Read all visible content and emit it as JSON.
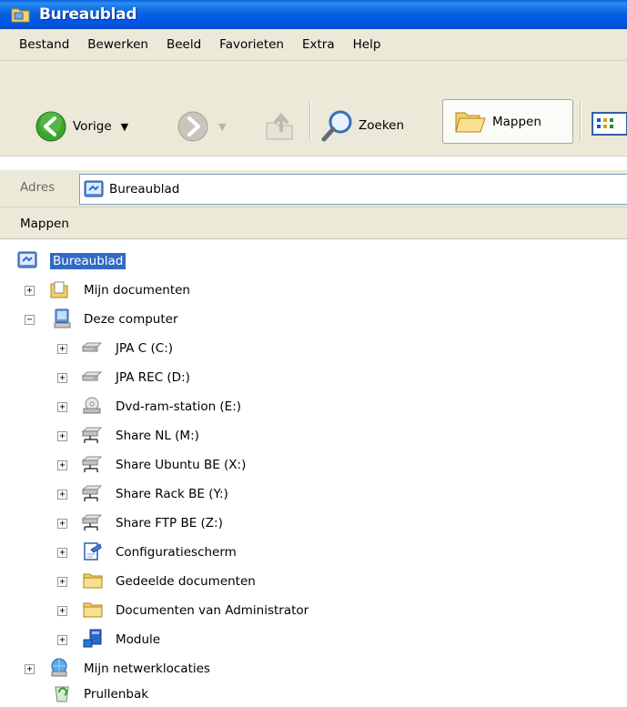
{
  "window": {
    "title": "Bureaublad"
  },
  "menu": [
    "Bestand",
    "Bewerken",
    "Beeld",
    "Favorieten",
    "Extra",
    "Help"
  ],
  "toolbar": {
    "back_label": "Vorige",
    "search_label": "Zoeken",
    "folders_label": "Mappen"
  },
  "address": {
    "label": "Adres",
    "value": "Bureaublad"
  },
  "pane": {
    "title": "Mappen"
  },
  "tree": [
    {
      "label": "Bureaublad",
      "icon": "desktop-icon"
    },
    {
      "label": "Mijn documenten",
      "icon": "my-documents-icon"
    },
    {
      "label": "Deze computer",
      "icon": "my-computer-icon"
    },
    {
      "label": "JPA C (C:)",
      "icon": "hard-drive-icon"
    },
    {
      "label": "JPA REC (D:)",
      "icon": "hard-drive-icon"
    },
    {
      "label": "Dvd-ram-station (E:)",
      "icon": "dvd-drive-icon"
    },
    {
      "label": "Share NL (M:)",
      "icon": "network-drive-icon"
    },
    {
      "label": "Share Ubuntu BE (X:)",
      "icon": "network-drive-icon"
    },
    {
      "label": "Share Rack BE (Y:)",
      "icon": "network-drive-icon"
    },
    {
      "label": "Share FTP BE (Z:)",
      "icon": "network-drive-icon"
    },
    {
      "label": "Configuratiescherm",
      "icon": "control-panel-icon"
    },
    {
      "label": "Gedeelde documenten",
      "icon": "folder-icon"
    },
    {
      "label": "Documenten van Administrator",
      "icon": "folder-icon"
    },
    {
      "label": "Module",
      "icon": "module-icon"
    },
    {
      "label": "Mijn netwerklocaties",
      "icon": "network-places-icon"
    },
    {
      "label": "Prullenbak",
      "icon": "recycle-bin-icon"
    }
  ],
  "colors": {
    "title_bar": "#0054e3",
    "selection": "#316ac5",
    "chrome": "#ece9d8"
  }
}
